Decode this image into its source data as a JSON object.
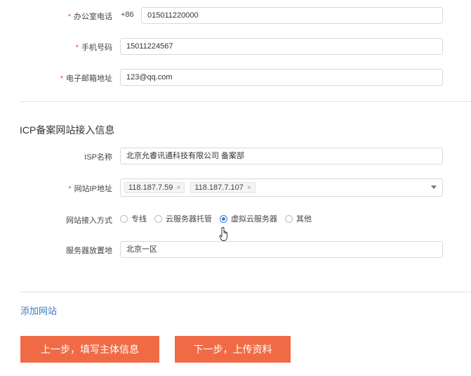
{
  "contact": {
    "office_phone_label": "办公室电话",
    "office_phone_prefix": "+86",
    "office_phone_value": "015011220000",
    "mobile_label": "手机号码",
    "mobile_value": "15011224567",
    "email_label": "电子邮箱地址",
    "email_value": "123@qq.com",
    "required_mark": "*"
  },
  "icp_section": {
    "title": "ICP备案网站接入信息",
    "isp_label": "ISP名称",
    "isp_value": "北京允睿讯通科技有限公司 备案部",
    "ip_label": "网站IP地址",
    "ip_tags": [
      "118.187.7.59",
      "118.187.7.107"
    ],
    "tag_close_glyph": "×",
    "access_label": "网站接入方式",
    "access_options": [
      "专线",
      "云服务器托管",
      "虚拟云服务器",
      "其他"
    ],
    "access_selected": "虚拟云服务器",
    "location_label": "服务器放置地",
    "location_value": "北京一区"
  },
  "actions": {
    "add_site_link": "添加网站",
    "prev_button": "上一步，填写主体信息",
    "next_button": "下一步，上传资料"
  },
  "colors": {
    "accent": "#f06b45",
    "link": "#3b7bc0",
    "radio_checked": "#2f7fd6",
    "required": "#e8553a"
  },
  "icons": {
    "dropdown": "chevron-down-icon",
    "cursor": "hand-pointer-icon"
  }
}
